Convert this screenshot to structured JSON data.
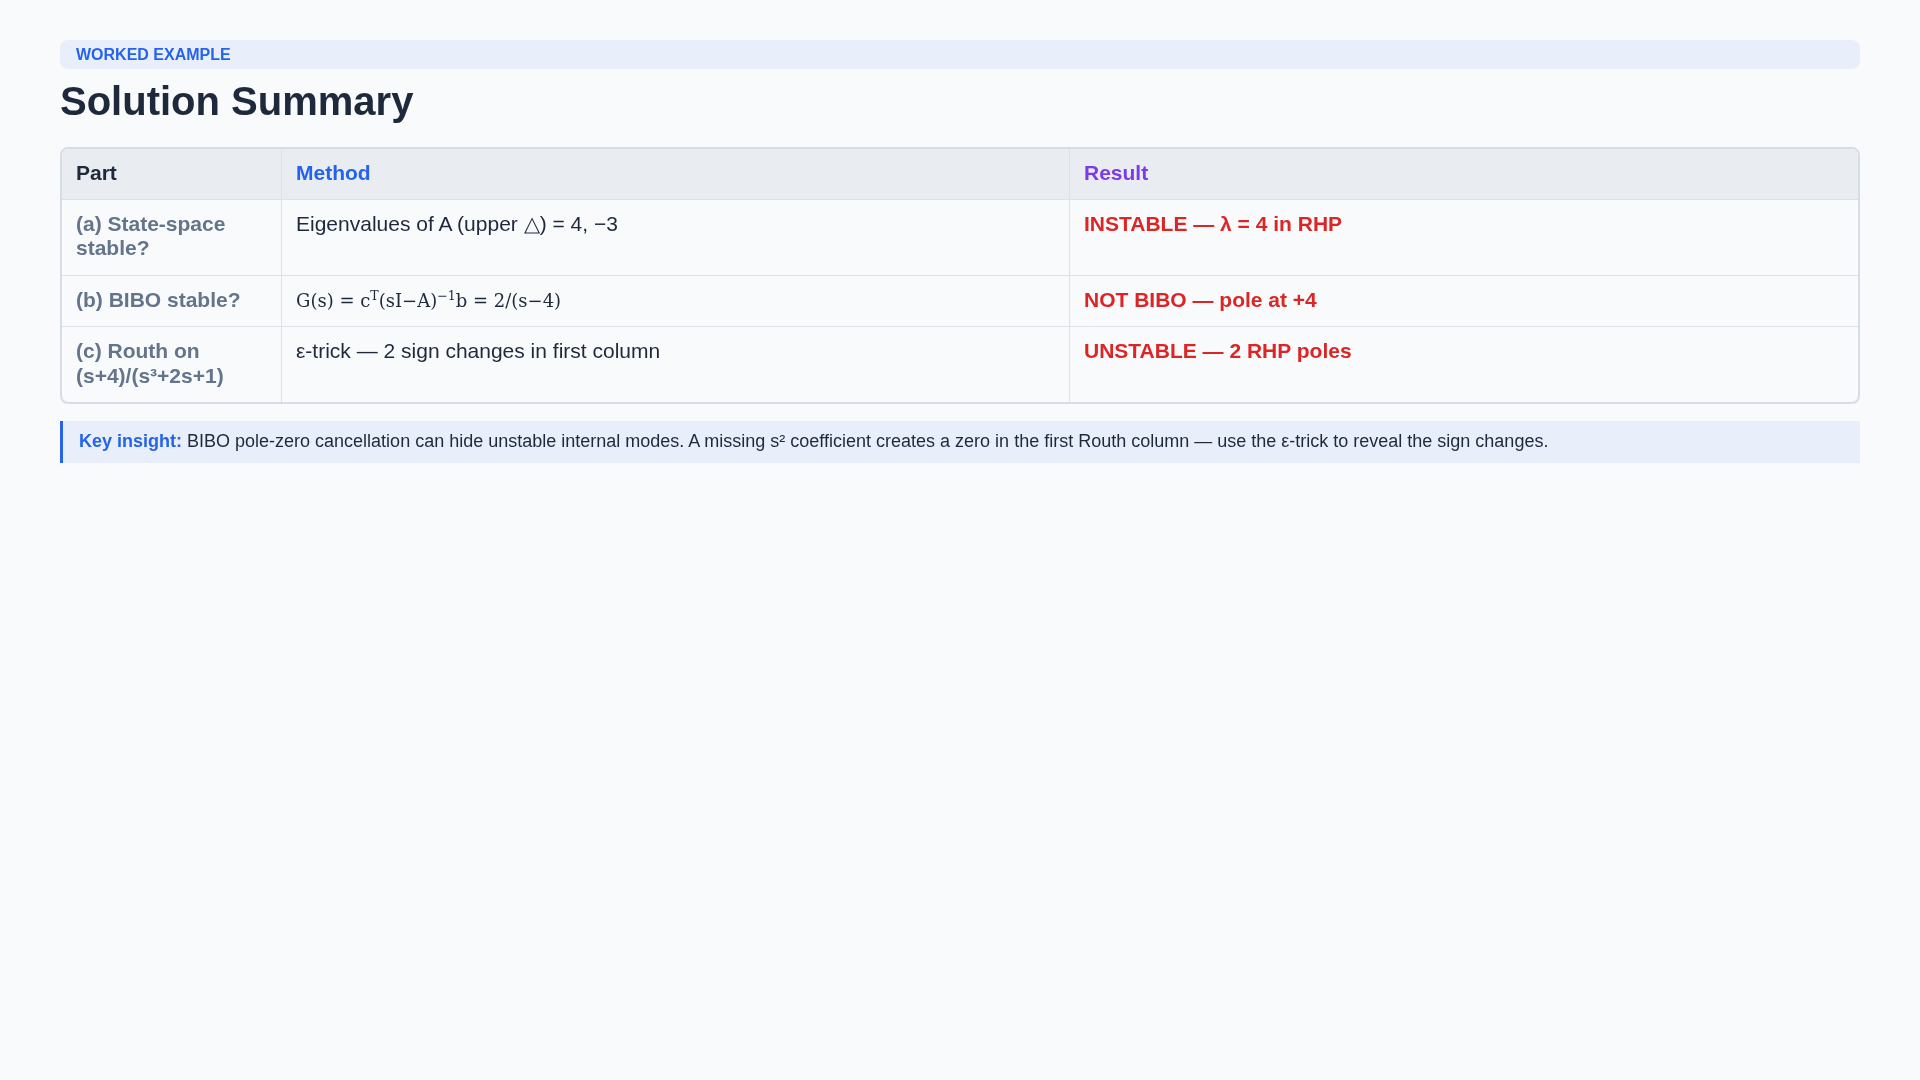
{
  "eyebrow": "WORKED EXAMPLE",
  "title": "Solution Summary",
  "table": {
    "columns": [
      "Part",
      "Method",
      "Result"
    ],
    "rows": [
      {
        "part": "(a) State-space stable?",
        "method": {
          "kind": "text",
          "text": "Eigenvalues of A (upper △) = 4, −3"
        },
        "result": "INSTABLE — λ = 4 in RHP"
      },
      {
        "part": "(b) BIBO stable?",
        "method": {
          "kind": "math",
          "text": "G(s) = c$^{T}$(sI−A)$^{−1}$b = 2/(s−4)"
        },
        "result": "NOT BIBO — pole at +4"
      },
      {
        "part": "(c) Routh on (s+4)/(s³+2s+1)",
        "method": {
          "kind": "text",
          "text": "ε-trick — 2 sign changes in first column"
        },
        "result": "UNSTABLE — 2 RHP poles"
      }
    ]
  },
  "insight": "**Key insight:** BIBO pole-zero cancellation can hide unstable internal modes. A missing s² coefficient creates a zero in the first Routh column — use the ε-trick to reveal the sign changes."
}
